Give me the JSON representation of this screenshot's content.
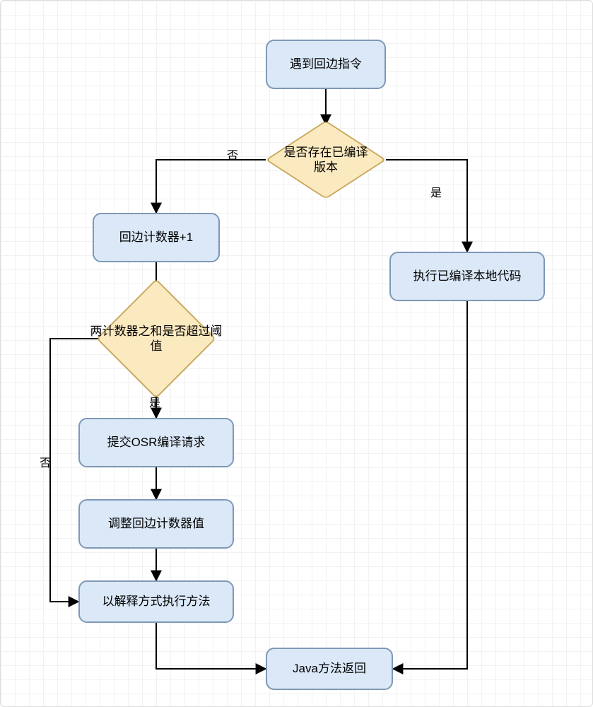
{
  "nodes": {
    "start": {
      "label": "遇到回边指令"
    },
    "dec_compiled": {
      "label": "是否存在已编译版本"
    },
    "inc_counter": {
      "label": "回边计数器+1"
    },
    "exec_native": {
      "label": "执行已编译本地代码"
    },
    "dec_threshold": {
      "label": "两计数器之和是否超过阈值"
    },
    "submit_osr": {
      "label": "提交OSR编译请求"
    },
    "adjust": {
      "label": "调整回边计数器值"
    },
    "interpret": {
      "label": "以解释方式执行方法"
    },
    "return": {
      "label": "Java方法返回"
    }
  },
  "edge_labels": {
    "compiled_no": "否",
    "compiled_yes": "是",
    "threshold_yes": "是",
    "threshold_no": "否"
  },
  "colors": {
    "process_fill": "#dbe8f7",
    "process_stroke": "#7e98b7",
    "decision_fill": "#fbe9c0",
    "decision_stroke": "#c9a95f",
    "edge": "#000000"
  },
  "chart_data": {
    "type": "flowchart",
    "nodes": [
      {
        "id": "start",
        "kind": "process",
        "label": "遇到回边指令"
      },
      {
        "id": "dec_compiled",
        "kind": "decision",
        "label": "是否存在已编译版本"
      },
      {
        "id": "inc_counter",
        "kind": "process",
        "label": "回边计数器+1"
      },
      {
        "id": "exec_native",
        "kind": "process",
        "label": "执行已编译本地代码"
      },
      {
        "id": "dec_threshold",
        "kind": "decision",
        "label": "两计数器之和是否超过阈值"
      },
      {
        "id": "submit_osr",
        "kind": "process",
        "label": "提交OSR编译请求"
      },
      {
        "id": "adjust",
        "kind": "process",
        "label": "调整回边计数器值"
      },
      {
        "id": "interpret",
        "kind": "process",
        "label": "以解释方式执行方法"
      },
      {
        "id": "return",
        "kind": "process",
        "label": "Java方法返回"
      }
    ],
    "edges": [
      {
        "from": "start",
        "to": "dec_compiled",
        "label": ""
      },
      {
        "from": "dec_compiled",
        "to": "inc_counter",
        "label": "否"
      },
      {
        "from": "dec_compiled",
        "to": "exec_native",
        "label": "是"
      },
      {
        "from": "inc_counter",
        "to": "dec_threshold",
        "label": ""
      },
      {
        "from": "dec_threshold",
        "to": "submit_osr",
        "label": "是"
      },
      {
        "from": "dec_threshold",
        "to": "interpret",
        "label": "否"
      },
      {
        "from": "submit_osr",
        "to": "adjust",
        "label": ""
      },
      {
        "from": "adjust",
        "to": "interpret",
        "label": ""
      },
      {
        "from": "interpret",
        "to": "return",
        "label": ""
      },
      {
        "from": "exec_native",
        "to": "return",
        "label": ""
      }
    ]
  }
}
